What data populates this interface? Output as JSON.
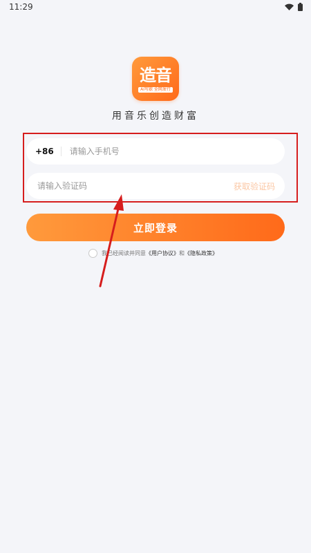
{
  "status_bar": {
    "time": "11:29",
    "icons": [
      "wifi-icon",
      "battery-icon"
    ]
  },
  "logo": {
    "text": "造音",
    "tagline": "AI写歌 全网发行",
    "accent_start": "#ff9a3c",
    "accent_end": "#ff6a1a"
  },
  "slogan": "用音乐创造财富",
  "form": {
    "country_code": "+86",
    "phone_placeholder": "请输入手机号",
    "code_placeholder": "请输入验证码",
    "get_code_label": "获取验证码"
  },
  "login_button": "立即登录",
  "agreement": {
    "prefix": "我已经阅读并同意",
    "user_agreement": "《用户协议》",
    "conjunction": "和",
    "privacy_policy": "《隐私政策》"
  },
  "annotation": {
    "highlight_color": "#d61d1d"
  }
}
